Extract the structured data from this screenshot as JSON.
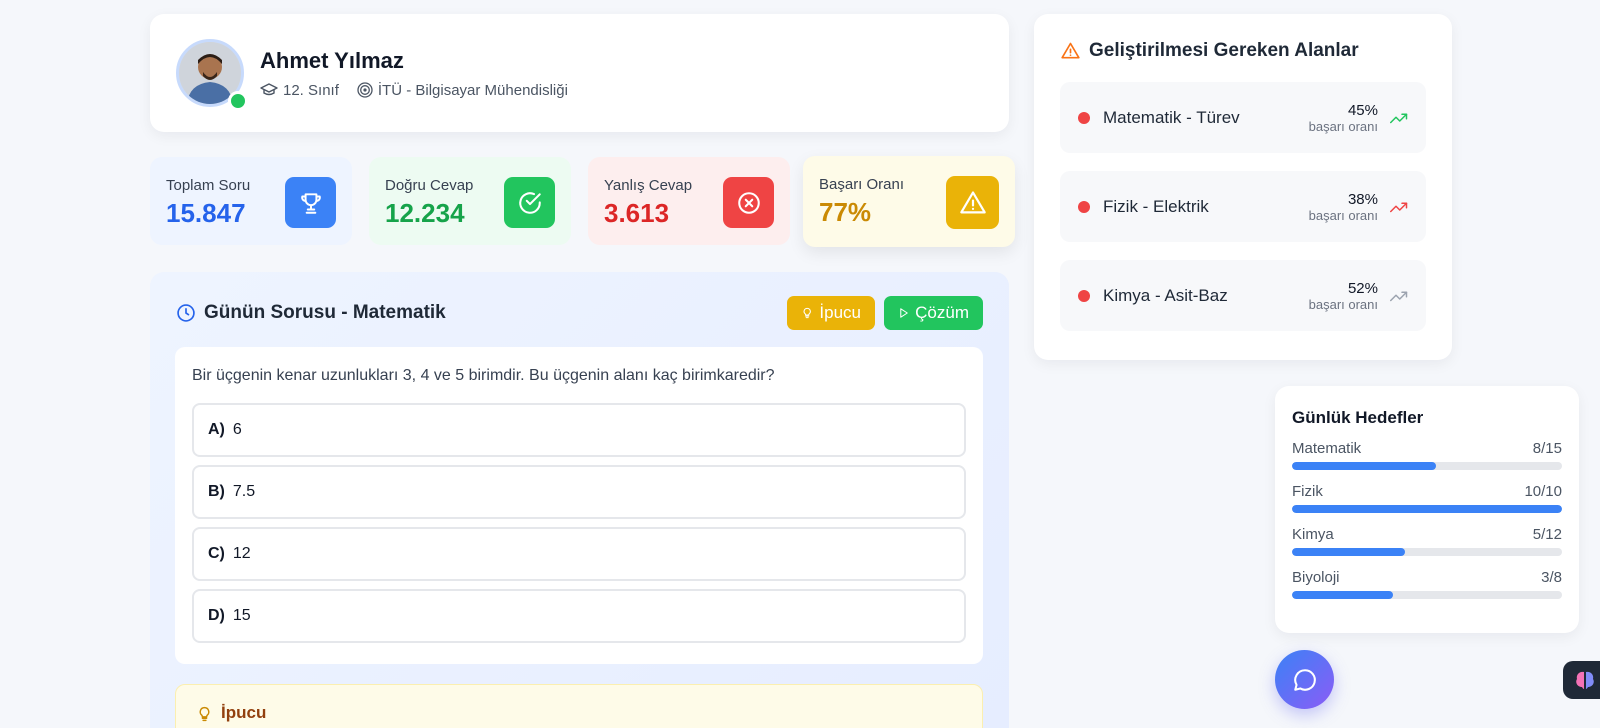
{
  "profile": {
    "name": "Ahmet Yılmaz",
    "grade": "12. Sınıf",
    "target": "İTÜ - Bilgisayar Mühendisliği"
  },
  "stats": [
    {
      "label": "Toplam Soru",
      "value": "15.847",
      "color": "#2563eb",
      "bg": "#eef4ff",
      "icon": "trophy-icon",
      "icon_bg": "#3b82f6"
    },
    {
      "label": "Doğru Cevap",
      "value": "12.234",
      "color": "#16a34a",
      "bg": "#edfbf2",
      "icon": "check-circle-icon",
      "icon_bg": "#22c55e"
    },
    {
      "label": "Yanlış Cevap",
      "value": "3.613",
      "color": "#dc2626",
      "bg": "#fdeeee",
      "icon": "x-circle-icon",
      "icon_bg": "#ef4444"
    },
    {
      "label": "Başarı Oranı",
      "value": "77%",
      "color": "#ca8a04",
      "bg": "#fefbe8",
      "icon": "warning-icon",
      "icon_bg": "#eab308"
    }
  ],
  "question": {
    "title": "Günün Sorusu - Matematik",
    "hint_button": "İpucu",
    "solution_button": "Çözüm",
    "text": "Bir üçgenin kenar uzunlukları 3, 4 ve 5 birimdir. Bu üçgenin alanı kaç birimkaredir?",
    "options": [
      {
        "letter": "A)",
        "value": "6"
      },
      {
        "letter": "B)",
        "value": "7.5"
      },
      {
        "letter": "C)",
        "value": "12"
      },
      {
        "letter": "D)",
        "value": "15"
      }
    ],
    "hint_title": "İpucu"
  },
  "improve": {
    "title": "Geliştirilmesi Gereken Alanlar",
    "items": [
      {
        "name": "Matematik - Türev",
        "pct": "45%",
        "sub": "başarı oranı",
        "trend": "trend-up-icon",
        "trend_color": "#22c55e"
      },
      {
        "name": "Fizik - Elektrik",
        "pct": "38%",
        "sub": "başarı oranı",
        "trend": "trend-up-icon",
        "trend_color": "#ef4444"
      },
      {
        "name": "Kimya - Asit-Baz",
        "pct": "52%",
        "sub": "başarı oranı",
        "trend": "trend-up-icon",
        "trend_color": "#9ca3af"
      }
    ]
  },
  "goals": {
    "title": "Günlük Hedefler",
    "items": [
      {
        "subject": "Matematik",
        "progress": "8/15",
        "fraction": 0.533
      },
      {
        "subject": "Fizik",
        "progress": "10/10",
        "fraction": 1.0
      },
      {
        "subject": "Kimya",
        "progress": "5/12",
        "fraction": 0.417
      },
      {
        "subject": "Biyoloji",
        "progress": "3/8",
        "fraction": 0.375
      }
    ]
  }
}
